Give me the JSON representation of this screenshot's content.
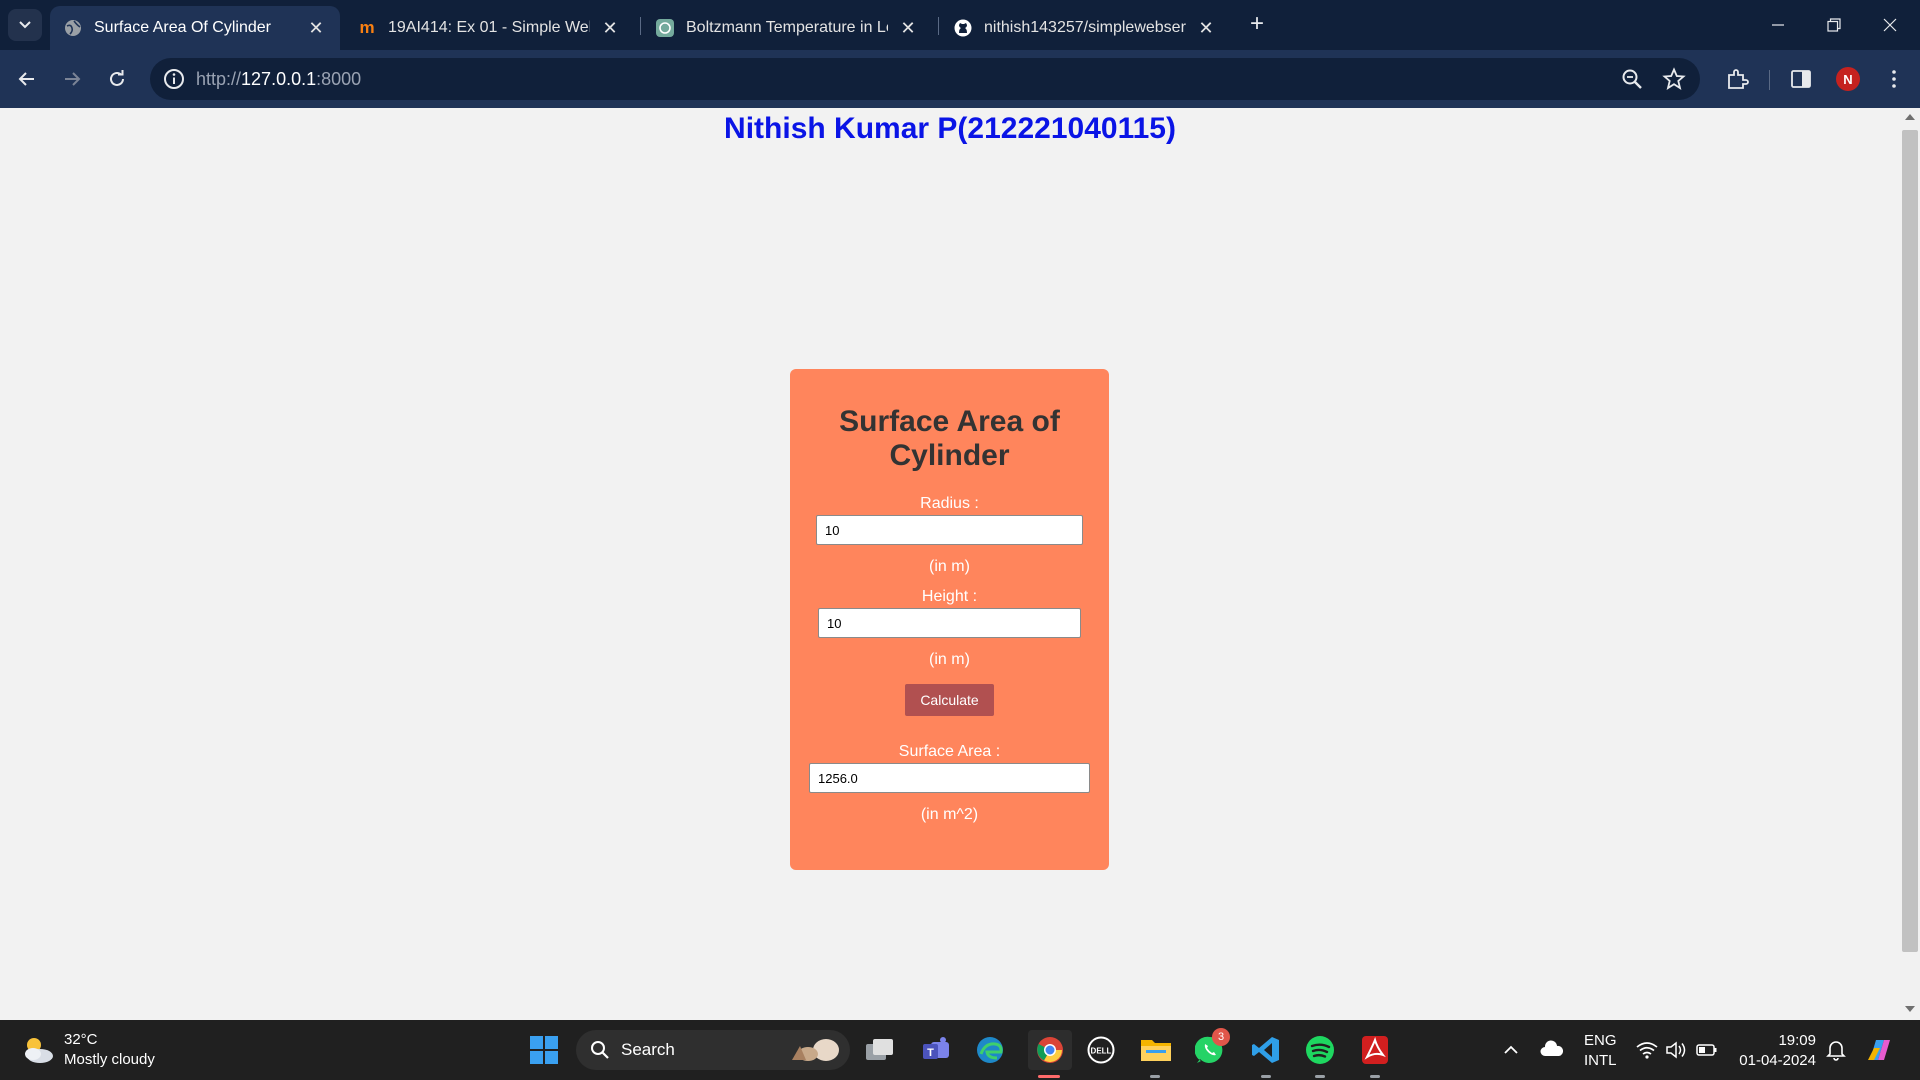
{
  "browser": {
    "tabs": [
      {
        "title": "Surface Area Of Cylinder",
        "active": true
      },
      {
        "title": "19AI414: Ex 01 - Simple Webser",
        "active": false
      },
      {
        "title": "Boltzmann Temperature in Lear",
        "active": false
      },
      {
        "title": "nithish143257/simplewebserver",
        "active": false
      }
    ],
    "url_scheme": "http://",
    "url_host": "127.0.0.1",
    "url_port": ":8000",
    "profile_initial": "N"
  },
  "page": {
    "heading": "Nithish Kumar P(212221040115)",
    "card_title": "Surface Area of Cylinder",
    "radius_label": "Radius :",
    "radius_value": "10",
    "radius_unit": "(in m)",
    "height_label": "Height :",
    "height_value": "10",
    "height_unit": "(in m)",
    "calculate_label": "Calculate",
    "area_label": "Surface Area :",
    "area_value": "1256.0",
    "area_unit": "(in m^2)"
  },
  "taskbar": {
    "temperature": "32°C",
    "weather": "Mostly cloudy",
    "search_label": "Search",
    "whatsapp_badge": "3",
    "lang_top": "ENG",
    "lang_bottom": "INTL",
    "time": "19:09",
    "date": "01-04-2024"
  },
  "colors": {
    "heading": "#0a14e6",
    "card": "#ff855c",
    "button": "#b15050",
    "tabstrip": "#10203a",
    "toolbar": "#1f3356"
  }
}
